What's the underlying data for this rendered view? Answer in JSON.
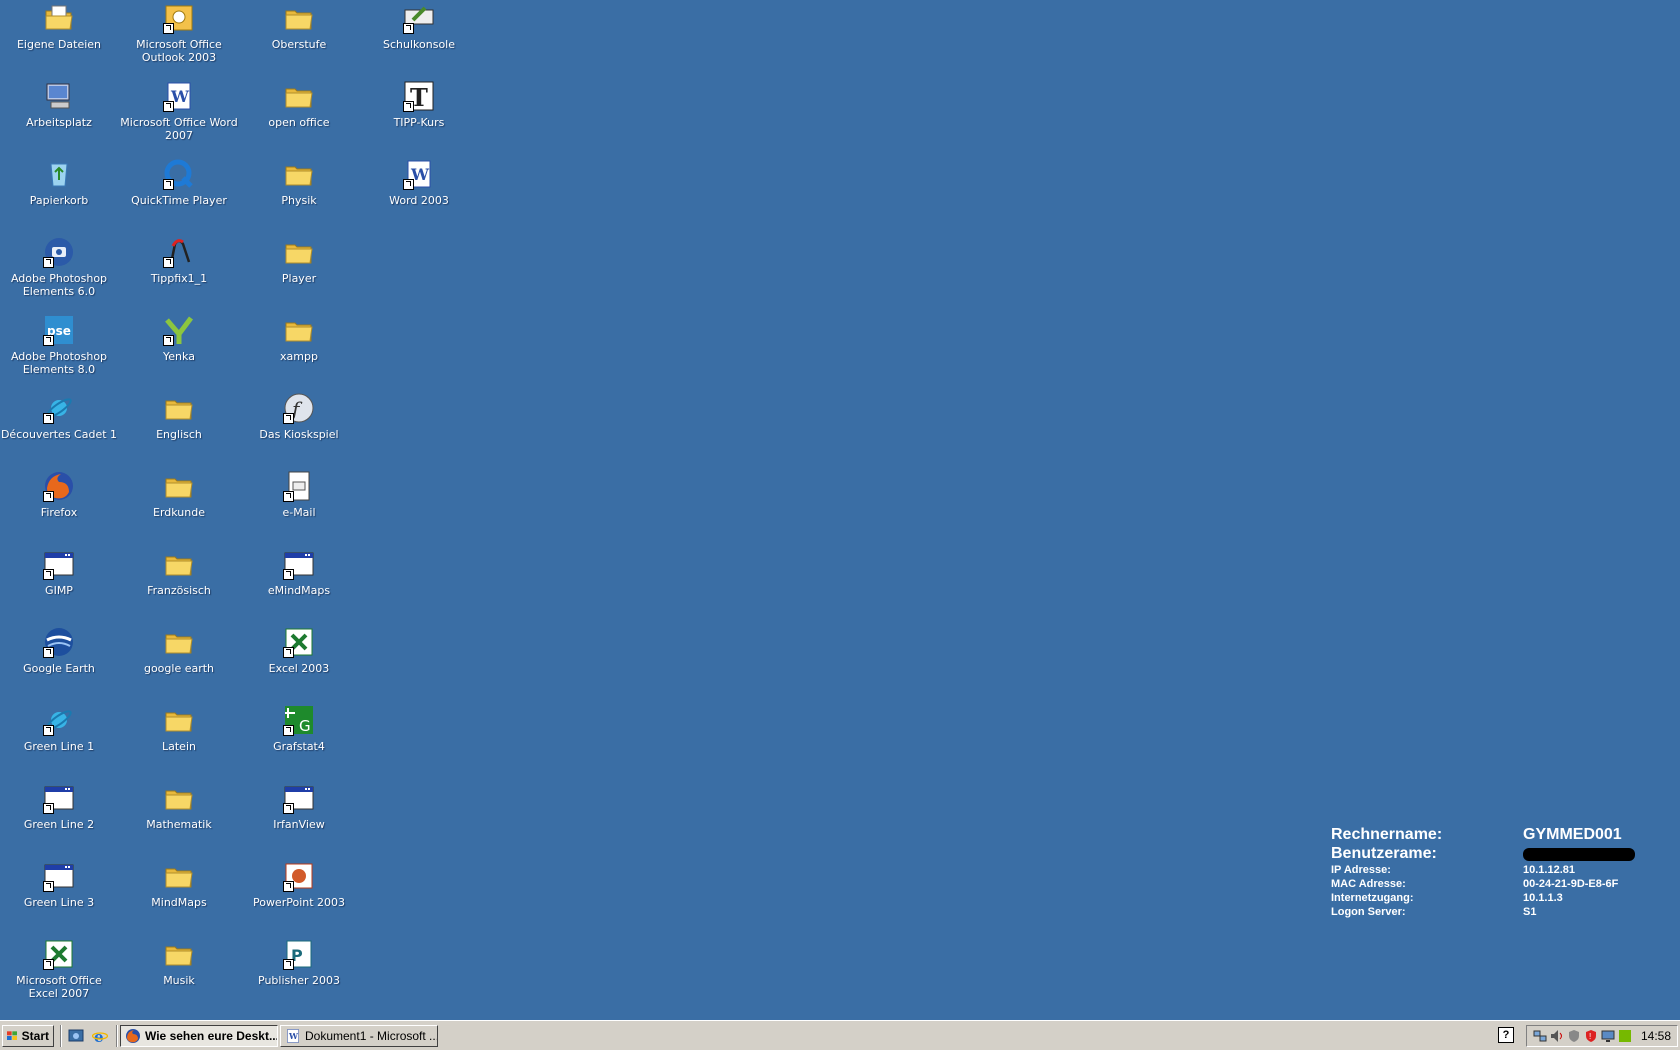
{
  "desktop": {
    "background_color": "#3a6ea5",
    "icons": [
      {
        "label": "Eigene Dateien",
        "icon": "my-documents-icon",
        "col": 0,
        "row": 0,
        "shortcut": false
      },
      {
        "label": "Arbeitsplatz",
        "icon": "my-computer-icon",
        "col": 0,
        "row": 1,
        "shortcut": false
      },
      {
        "label": "Papierkorb",
        "icon": "recycle-bin-icon",
        "col": 0,
        "row": 2,
        "shortcut": false
      },
      {
        "label": "Adobe Photoshop Elements 6.0",
        "icon": "camera-icon",
        "col": 0,
        "row": 3,
        "shortcut": true
      },
      {
        "label": "Adobe Photoshop Elements 8.0",
        "icon": "pse-icon",
        "col": 0,
        "row": 4,
        "shortcut": true
      },
      {
        "label": "Découvertes Cadet 1",
        "icon": "planet-icon",
        "col": 0,
        "row": 5,
        "shortcut": true
      },
      {
        "label": "Firefox",
        "icon": "firefox-icon",
        "col": 0,
        "row": 6,
        "shortcut": true
      },
      {
        "label": "GIMP",
        "icon": "window-icon",
        "col": 0,
        "row": 7,
        "shortcut": true
      },
      {
        "label": "Google Earth",
        "icon": "globe-icon",
        "col": 0,
        "row": 8,
        "shortcut": true
      },
      {
        "label": "Green Line 1",
        "icon": "planet-icon",
        "col": 0,
        "row": 9,
        "shortcut": true
      },
      {
        "label": "Green Line 2",
        "icon": "window-icon",
        "col": 0,
        "row": 10,
        "shortcut": true
      },
      {
        "label": "Green Line 3",
        "icon": "window-icon",
        "col": 0,
        "row": 11,
        "shortcut": true
      },
      {
        "label": "Microsoft Office Excel 2007",
        "icon": "excel-icon",
        "col": 0,
        "row": 12,
        "shortcut": true
      },
      {
        "label": "Microsoft Office Outlook 2003",
        "icon": "outlook-icon",
        "col": 1,
        "row": 0,
        "shortcut": true
      },
      {
        "label": "Microsoft Office Word 2007",
        "icon": "word-icon",
        "col": 1,
        "row": 1,
        "shortcut": true
      },
      {
        "label": "QuickTime Player",
        "icon": "quicktime-icon",
        "col": 1,
        "row": 2,
        "shortcut": true
      },
      {
        "label": "Tippfix1_1",
        "icon": "tippfix-icon",
        "col": 1,
        "row": 3,
        "shortcut": true
      },
      {
        "label": "Yenka",
        "icon": "yenka-icon",
        "col": 1,
        "row": 4,
        "shortcut": true
      },
      {
        "label": "Englisch",
        "icon": "folder-icon",
        "col": 1,
        "row": 5,
        "shortcut": false
      },
      {
        "label": "Erdkunde",
        "icon": "folder-icon",
        "col": 1,
        "row": 6,
        "shortcut": false
      },
      {
        "label": "Französisch",
        "icon": "folder-icon",
        "col": 1,
        "row": 7,
        "shortcut": false
      },
      {
        "label": "google earth",
        "icon": "folder-icon",
        "col": 1,
        "row": 8,
        "shortcut": false
      },
      {
        "label": "Latein",
        "icon": "folder-icon",
        "col": 1,
        "row": 9,
        "shortcut": false
      },
      {
        "label": "Mathematik",
        "icon": "folder-icon",
        "col": 1,
        "row": 10,
        "shortcut": false
      },
      {
        "label": "MindMaps",
        "icon": "folder-icon",
        "col": 1,
        "row": 11,
        "shortcut": false
      },
      {
        "label": "Musik",
        "icon": "folder-icon",
        "col": 1,
        "row": 12,
        "shortcut": false
      },
      {
        "label": "Oberstufe",
        "icon": "folder-icon",
        "col": 2,
        "row": 0,
        "shortcut": false
      },
      {
        "label": "open office",
        "icon": "folder-icon",
        "col": 2,
        "row": 1,
        "shortcut": false
      },
      {
        "label": "Physik",
        "icon": "folder-icon",
        "col": 2,
        "row": 2,
        "shortcut": false
      },
      {
        "label": "Player",
        "icon": "folder-icon",
        "col": 2,
        "row": 3,
        "shortcut": false
      },
      {
        "label": "xampp",
        "icon": "folder-icon",
        "col": 2,
        "row": 4,
        "shortcut": false
      },
      {
        "label": "Das Kioskspiel",
        "icon": "flash-icon",
        "col": 2,
        "row": 5,
        "shortcut": true
      },
      {
        "label": "e-Mail",
        "icon": "email-icon",
        "col": 2,
        "row": 6,
        "shortcut": true
      },
      {
        "label": "eMindMaps",
        "icon": "window-icon",
        "col": 2,
        "row": 7,
        "shortcut": true
      },
      {
        "label": "Excel 2003",
        "icon": "excel-icon",
        "col": 2,
        "row": 8,
        "shortcut": true
      },
      {
        "label": "Grafstat4",
        "icon": "grafstat-icon",
        "col": 2,
        "row": 9,
        "shortcut": true
      },
      {
        "label": "IrfanView",
        "icon": "window-icon",
        "col": 2,
        "row": 10,
        "shortcut": true
      },
      {
        "label": "PowerPoint 2003",
        "icon": "powerpoint-icon",
        "col": 2,
        "row": 11,
        "shortcut": true
      },
      {
        "label": "Publisher 2003",
        "icon": "publisher-icon",
        "col": 2,
        "row": 12,
        "shortcut": true
      },
      {
        "label": "Schulkonsole",
        "icon": "schulkonsole-icon",
        "col": 3,
        "row": 0,
        "shortcut": true
      },
      {
        "label": "TIPP-Kurs",
        "icon": "tipp-kurs-icon",
        "col": 3,
        "row": 1,
        "shortcut": true
      },
      {
        "label": "Word 2003",
        "icon": "word-icon",
        "col": 3,
        "row": 2,
        "shortcut": true
      }
    ]
  },
  "sysinfo": {
    "rechnername_label": "Rechnername:",
    "rechnername_value": "GYMMED001",
    "benutzername_label": "Benutzerame:",
    "ip_label": "IP Adresse:",
    "ip_value": "10.1.12.81",
    "mac_label": "MAC Adresse:",
    "mac_value": "00-24-21-9D-E8-6F",
    "internet_label": "Internetzugang:",
    "internet_value": "10.1.1.3",
    "logon_label": "Logon Server:",
    "logon_value": "S1"
  },
  "taskbar": {
    "start_label": "Start",
    "tasks": [
      {
        "label": "Wie sehen eure Deskt...",
        "icon": "firefox-icon",
        "active": true
      },
      {
        "label": "Dokument1 - Microsoft ...",
        "icon": "word-icon",
        "active": false
      }
    ],
    "clock": "14:58",
    "help_glyph": "?"
  },
  "colors": {
    "desktop": "#3a6ea5",
    "taskbar": "#d4d0c8",
    "folder": "#f5d565"
  }
}
